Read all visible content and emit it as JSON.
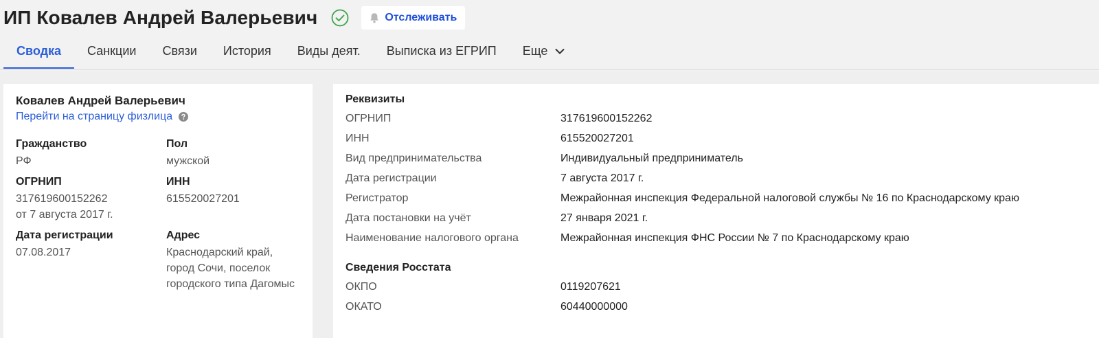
{
  "header": {
    "title": "ИП Ковалев Андрей Валерьевич",
    "follow_label": "Отслеживать",
    "tabs": [
      {
        "label": "Сводка"
      },
      {
        "label": "Санкции"
      },
      {
        "label": "Связи"
      },
      {
        "label": "История"
      },
      {
        "label": "Виды деят."
      },
      {
        "label": "Выписка из ЕГРИП"
      },
      {
        "label": "Еще"
      }
    ]
  },
  "summary": {
    "name": "Ковалев Андрей Валерьевич",
    "person_link": "Перейти на страницу физлица",
    "fields": {
      "citizenship": {
        "label": "Гражданство",
        "value": "РФ"
      },
      "gender": {
        "label": "Пол",
        "value": "мужской"
      },
      "ogrnip": {
        "label": "ОГРНИП",
        "value": "317619600152262",
        "date": "от 7 августа 2017 г."
      },
      "inn": {
        "label": "ИНН",
        "value": "615520027201"
      },
      "reg_date": {
        "label": "Дата регистрации",
        "value": "07.08.2017"
      },
      "address": {
        "label": "Адрес",
        "value": "Краснодарский край, город Сочи, поселок городского типа Дагомыс"
      }
    }
  },
  "requisites": {
    "title": "Реквизиты",
    "rows": [
      {
        "label": "ОГРНИП",
        "value": "317619600152262"
      },
      {
        "label": "ИНН",
        "value": "615520027201"
      },
      {
        "label": "Вид предпринимательства",
        "value": "Индивидуальный предприниматель"
      },
      {
        "label": "Дата регистрации",
        "value": "7 августа 2017 г."
      },
      {
        "label": "Регистратор",
        "value": "Межрайонная инспекция Федеральной налоговой службы № 16 по Краснодарскому краю"
      },
      {
        "label": "Дата постановки на учёт",
        "value": "27 января 2021 г."
      },
      {
        "label": "Наименование налогового органа",
        "value": "Межрайонная инспекция ФНС России № 7 по Краснодарскому краю"
      }
    ]
  },
  "rosstat": {
    "title": "Сведения Росстата",
    "rows": [
      {
        "label": "ОКПО",
        "value": "0119207621"
      },
      {
        "label": "ОКАТО",
        "value": "60440000000"
      }
    ]
  },
  "colors": {
    "accent": "#2b5ed8",
    "check_green": "#3aa54a"
  }
}
